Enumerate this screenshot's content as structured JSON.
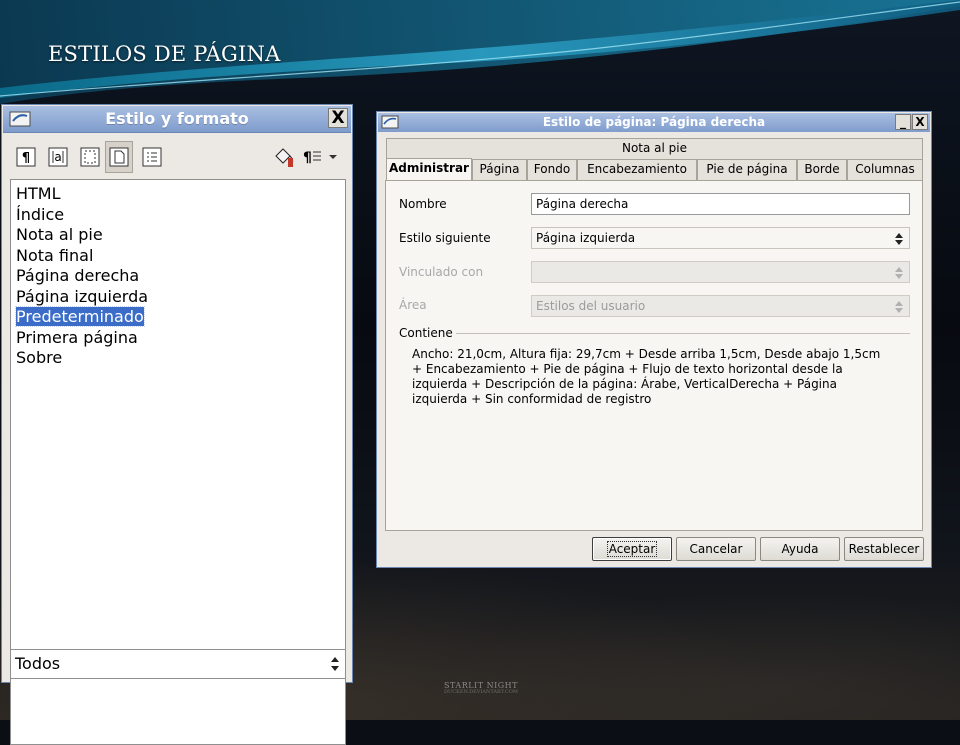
{
  "slide": {
    "title": "ESTILOS DE PÁGINA",
    "watermark": [
      "STARLIT NIGHT",
      "DUCKEN.DEVIANTART.COM"
    ]
  },
  "stylist": {
    "window_title": "Estilo y formato",
    "close_label": "X",
    "toolbar": [
      {
        "name": "paragraph-styles-icon",
        "active": false
      },
      {
        "name": "character-styles-icon",
        "active": false
      },
      {
        "name": "frame-styles-icon",
        "active": false
      },
      {
        "name": "page-styles-icon",
        "active": true
      },
      {
        "name": "list-styles-icon",
        "active": false
      },
      {
        "name": "fill-format-mode-icon",
        "active": false
      },
      {
        "name": "new-style-from-selection-icon",
        "active": false
      }
    ],
    "styles": [
      "HTML",
      "Índice",
      "Nota al pie",
      "Nota final",
      "Página derecha",
      "Página izquierda",
      "Predeterminado",
      "Primera página",
      "Sobre"
    ],
    "selected_style": "Predeterminado",
    "filter": "Todos"
  },
  "dialog": {
    "window_title": "Estilo de página: Página derecha",
    "minimize_label": "_",
    "close_label": "X",
    "tabs_top": [
      "Nota al pie"
    ],
    "tabs_bottom": [
      "Administrar",
      "Página",
      "Fondo",
      "Encabezamiento",
      "Pie de página",
      "Borde",
      "Columnas"
    ],
    "active_tab": "Administrar",
    "fields": {
      "nombre": {
        "label": "Nombre",
        "value": "Página derecha"
      },
      "estilo_siguiente": {
        "label": "Estilo siguiente",
        "value": "Página izquierda"
      },
      "vinculado_con": {
        "label": "Vinculado con",
        "value": "",
        "disabled": true
      },
      "area": {
        "label": "Área",
        "value": "Estilos del usuario",
        "disabled": true
      }
    },
    "contains_label": "Contiene",
    "description": "Ancho: 21,0cm, Altura fija: 29,7cm + Desde arriba 1,5cm, Desde abajo 1,5cm + Encabezamiento + Pie de página + Flujo de texto horizontal desde la izquierda + Descripción de la página:  Árabe, VerticalDerecha + Página izquierda + Sin conformidad de registro",
    "buttons": {
      "ok": "Aceptar",
      "cancel": "Cancelar",
      "help": "Ayuda",
      "reset": "Restablecer"
    }
  },
  "colors": {
    "titlebar": "#8fa9d6",
    "selection": "#3b6cc8",
    "dialog_bg": "#ece9e4"
  }
}
